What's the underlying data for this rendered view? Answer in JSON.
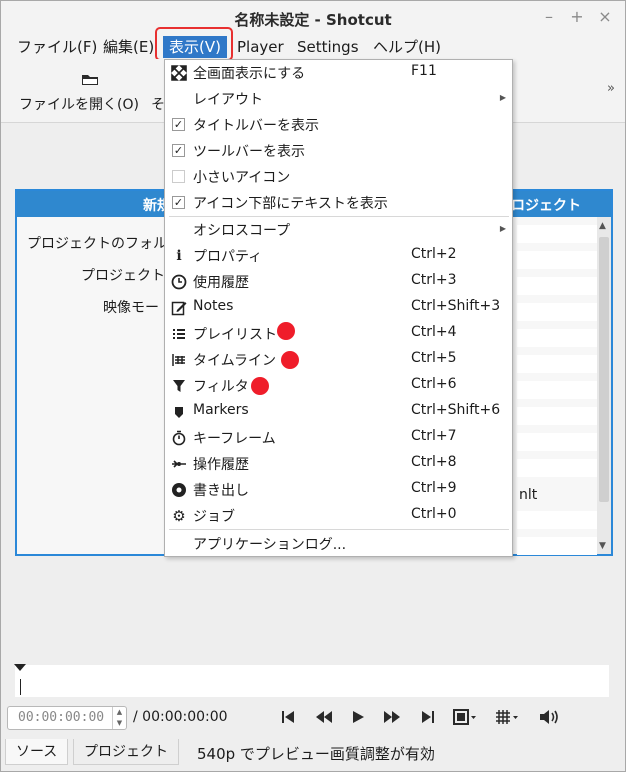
{
  "window": {
    "title": "名称未設定 - Shotcut"
  },
  "menubar": {
    "items": [
      "ファイル(F)",
      "編集(E)",
      "表示(V)",
      "Player",
      "Settings",
      "ヘルプ(H)"
    ]
  },
  "toolbar": {
    "open_label": "ファイルを開く(O)",
    "truncated_label": "そ",
    "extension_glyph": "»"
  },
  "panel": {
    "header_left": "新規",
    "header_right": "ロジェクト",
    "labels": [
      "プロジェクトのフォルダー",
      "プロジェクト名",
      "映像モー"
    ],
    "mlt_text": "nlt"
  },
  "view_menu": {
    "items": [
      {
        "label": "全画面表示にする",
        "shortcut": "F11",
        "icon": "fullscreen-icon"
      },
      {
        "label": "レイアウト",
        "submenu": true
      },
      {
        "label": "タイトルバーを表示",
        "checked": true
      },
      {
        "label": "ツールバーを表示",
        "checked": true
      },
      {
        "label": "小さいアイコン",
        "checked": false
      },
      {
        "label": "アイコン下部にテキストを表示",
        "checked": true
      },
      {
        "label": "オシロスコープ",
        "submenu": true
      },
      {
        "label": "プロパティ",
        "shortcut": "Ctrl+2",
        "icon": "info-icon"
      },
      {
        "label": "使用履歴",
        "shortcut": "Ctrl+3",
        "icon": "clock-icon"
      },
      {
        "label": "Notes",
        "shortcut": "Ctrl+Shift+3",
        "icon": "edit-note-icon"
      },
      {
        "label": "プレイリスト",
        "shortcut": "Ctrl+4",
        "icon": "list-icon"
      },
      {
        "label": "タイムライン",
        "shortcut": "Ctrl+5",
        "icon": "timeline-icon"
      },
      {
        "label": "フィルタ",
        "shortcut": "Ctrl+6",
        "icon": "filter-icon"
      },
      {
        "label": "Markers",
        "shortcut": "Ctrl+Shift+6",
        "icon": "marker-icon"
      },
      {
        "label": "キーフレーム",
        "shortcut": "Ctrl+7",
        "icon": "stopwatch-icon"
      },
      {
        "label": "操作履歴",
        "shortcut": "Ctrl+8",
        "icon": "history-icon"
      },
      {
        "label": "書き出し",
        "shortcut": "Ctrl+9",
        "icon": "export-icon"
      },
      {
        "label": "ジョブ",
        "shortcut": "Ctrl+0",
        "icon": "gear-icon"
      },
      {
        "label": "アプリケーションログ..."
      }
    ]
  },
  "transport": {
    "position": "00:00:00:00",
    "separator": "/",
    "duration": "00:00:00:00"
  },
  "tabs": [
    "ソース",
    "プロジェクト"
  ],
  "status": "540p でプレビュー画質調整が有効",
  "colors": {
    "accent": "#2f88cf",
    "menu_highlight": "#3078c8",
    "annotation_red": "#ef1d2a"
  }
}
